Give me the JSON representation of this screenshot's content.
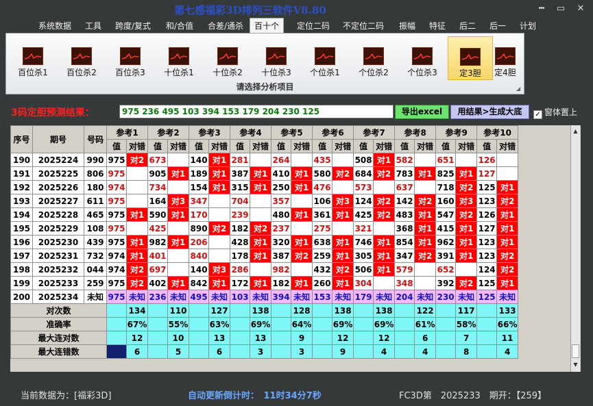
{
  "window": {
    "title": "第七感福彩3D排列三软件V8.80",
    "min": "━",
    "max": "▭",
    "close": "✕"
  },
  "menu": [
    "系统数据",
    "工具",
    "跨度/复式",
    "和/合值",
    "合差/通杀",
    "百十个",
    "定位二码",
    "不定位二码",
    "振幅",
    "特征",
    "后二",
    "后一",
    "计划"
  ],
  "menu_active": 5,
  "ribbon": {
    "buttons": [
      "百位杀1",
      "百位杀2",
      "百位杀3",
      "十位杀1",
      "十位杀2",
      "十位杀3",
      "个位杀1",
      "个位杀2",
      "个位杀3",
      "定3胆",
      "定4胆"
    ],
    "active": 9,
    "caption": "请选择分析项目",
    "icon": "chart-icon"
  },
  "result": {
    "label": "3码定胆预测结果：",
    "value": "975 236 495 103 394 153 179 204 230 125",
    "excel_btn": "导出excel",
    "gen_btn": "用结果>生成大底",
    "checkbox_label": "窗体置上",
    "checked": true
  },
  "table": {
    "headers": {
      "seq": "序号",
      "period": "期号",
      "number": "号码",
      "ref_prefix": "参考",
      "val": "值",
      "check": "对错"
    },
    "rows": [
      {
        "seq": "190",
        "period": "2025224",
        "num": "990",
        "refs": [
          [
            "975",
            "对2"
          ],
          [
            "673",
            ""
          ],
          [
            "140",
            "对1"
          ],
          [
            "281",
            ""
          ],
          [
            "264",
            ""
          ],
          [
            "435",
            ""
          ],
          [
            "508",
            "对1"
          ],
          [
            "582",
            ""
          ],
          [
            "651",
            ""
          ],
          [
            "126",
            ""
          ]
        ]
      },
      {
        "seq": "191",
        "period": "2025225",
        "num": "806",
        "refs": [
          [
            "975",
            ""
          ],
          [
            "905",
            "对1"
          ],
          [
            "189",
            "对1"
          ],
          [
            "387",
            "对1"
          ],
          [
            "410",
            "对1"
          ],
          [
            "580",
            "对2"
          ],
          [
            "684",
            "对2"
          ],
          [
            "783",
            "对1"
          ],
          [
            "825",
            "对1"
          ],
          [
            "127",
            ""
          ]
        ]
      },
      {
        "seq": "192",
        "period": "2025226",
        "num": "180",
        "refs": [
          [
            "974",
            ""
          ],
          [
            "734",
            ""
          ],
          [
            "154",
            "对1"
          ],
          [
            "315",
            "对1"
          ],
          [
            "250",
            "对1"
          ],
          [
            "476",
            ""
          ],
          [
            "573",
            ""
          ],
          [
            "637",
            ""
          ],
          [
            "718",
            "对2"
          ],
          [
            "125",
            "对1"
          ]
        ]
      },
      {
        "seq": "193",
        "period": "2025227",
        "num": "611",
        "refs": [
          [
            "975",
            ""
          ],
          [
            "164",
            "对3"
          ],
          [
            "347",
            ""
          ],
          [
            "704",
            ""
          ],
          [
            "357",
            ""
          ],
          [
            "106",
            "对3"
          ],
          [
            "124",
            "对2"
          ],
          [
            "142",
            "对2"
          ],
          [
            "160",
            "对3"
          ],
          [
            "123",
            "对2"
          ]
        ]
      },
      {
        "seq": "194",
        "period": "2025228",
        "num": "465",
        "refs": [
          [
            "975",
            "对1"
          ],
          [
            "590",
            "对1"
          ],
          [
            "170",
            ""
          ],
          [
            "239",
            ""
          ],
          [
            "480",
            "对1"
          ],
          [
            "361",
            "对1"
          ],
          [
            "425",
            "对2"
          ],
          [
            "483",
            "对1"
          ],
          [
            "547",
            "对2"
          ],
          [
            "126",
            "对1"
          ]
        ]
      },
      {
        "seq": "195",
        "period": "2025229",
        "num": "108",
        "refs": [
          [
            "975",
            ""
          ],
          [
            "425",
            ""
          ],
          [
            "890",
            "对2"
          ],
          [
            "182",
            "对2"
          ],
          [
            "237",
            ""
          ],
          [
            "275",
            ""
          ],
          [
            "321",
            ""
          ],
          [
            "368",
            "对1"
          ],
          [
            "415",
            "对1"
          ],
          [
            "127",
            "对1"
          ]
        ]
      },
      {
        "seq": "196",
        "period": "2025230",
        "num": "439",
        "refs": [
          [
            "975",
            "对1"
          ],
          [
            "982",
            "对1"
          ],
          [
            "206",
            ""
          ],
          [
            "428",
            "对1"
          ],
          [
            "320",
            "对1"
          ],
          [
            "638",
            "对1"
          ],
          [
            "746",
            "对1"
          ],
          [
            "854",
            "对1"
          ],
          [
            "962",
            "对1"
          ],
          [
            "123",
            "对1"
          ]
        ]
      },
      {
        "seq": "197",
        "period": "2025231",
        "num": "732",
        "refs": [
          [
            "974",
            "对1"
          ],
          [
            "401",
            ""
          ],
          [
            "840",
            ""
          ],
          [
            "178",
            "对1"
          ],
          [
            "387",
            "对2"
          ],
          [
            "259",
            "对1"
          ],
          [
            "305",
            "对1"
          ],
          [
            "347",
            "对2"
          ],
          [
            "391",
            "对1"
          ],
          [
            "123",
            "对2"
          ]
        ]
      },
      {
        "seq": "198",
        "period": "2025232",
        "num": "044",
        "refs": [
          [
            "974",
            "对2"
          ],
          [
            "697",
            ""
          ],
          [
            "140",
            "对3"
          ],
          [
            "286",
            ""
          ],
          [
            "982",
            ""
          ],
          [
            "432",
            "对2"
          ],
          [
            "506",
            "对1"
          ],
          [
            "579",
            ""
          ],
          [
            "652",
            ""
          ],
          [
            "124",
            "对2"
          ]
        ]
      },
      {
        "seq": "199",
        "period": "2025233",
        "num": "259",
        "refs": [
          [
            "975",
            "对2"
          ],
          [
            "402",
            "对1"
          ],
          [
            "842",
            "对1"
          ],
          [
            "172",
            "对1"
          ],
          [
            "182",
            "对1"
          ],
          [
            "260",
            "对1"
          ],
          [
            "304",
            ""
          ],
          [
            "348",
            ""
          ],
          [
            "392",
            "对2"
          ],
          [
            "125",
            "对1"
          ]
        ]
      },
      {
        "seq": "200",
        "period": "2025234",
        "num": "未知",
        "refs": [
          [
            "975",
            "未知"
          ],
          [
            "236",
            "未知"
          ],
          [
            "495",
            "未知"
          ],
          [
            "103",
            "未知"
          ],
          [
            "394",
            "未知"
          ],
          [
            "153",
            "未知"
          ],
          [
            "179",
            "未知"
          ],
          [
            "204",
            "未知"
          ],
          [
            "230",
            "未知"
          ],
          [
            "125",
            "未知"
          ]
        ]
      }
    ],
    "stats": [
      {
        "label": "对次数",
        "values": [
          "134",
          "110",
          "127",
          "138",
          "128",
          "138",
          "138",
          "122",
          "117",
          "133"
        ]
      },
      {
        "label": "准确率",
        "values": [
          "67%",
          "55%",
          "63%",
          "69%",
          "64%",
          "69%",
          "69%",
          "61%",
          "58%",
          "66%"
        ]
      },
      {
        "label": "最大连对数",
        "values": [
          "12",
          "10",
          "13",
          "13",
          "9",
          "12",
          "12",
          "6",
          "7",
          "11"
        ]
      },
      {
        "label": "最大连错数",
        "values": [
          "6",
          "5",
          "6",
          "3",
          "3",
          "9",
          "4",
          "4",
          "8",
          "4"
        ]
      }
    ]
  },
  "status": {
    "current": "当前数据为：[福彩3D]",
    "countdown": "自动更新倒计时：　11时34分7秒",
    "issue": "FC3D第　2025233　期开：【259】"
  }
}
